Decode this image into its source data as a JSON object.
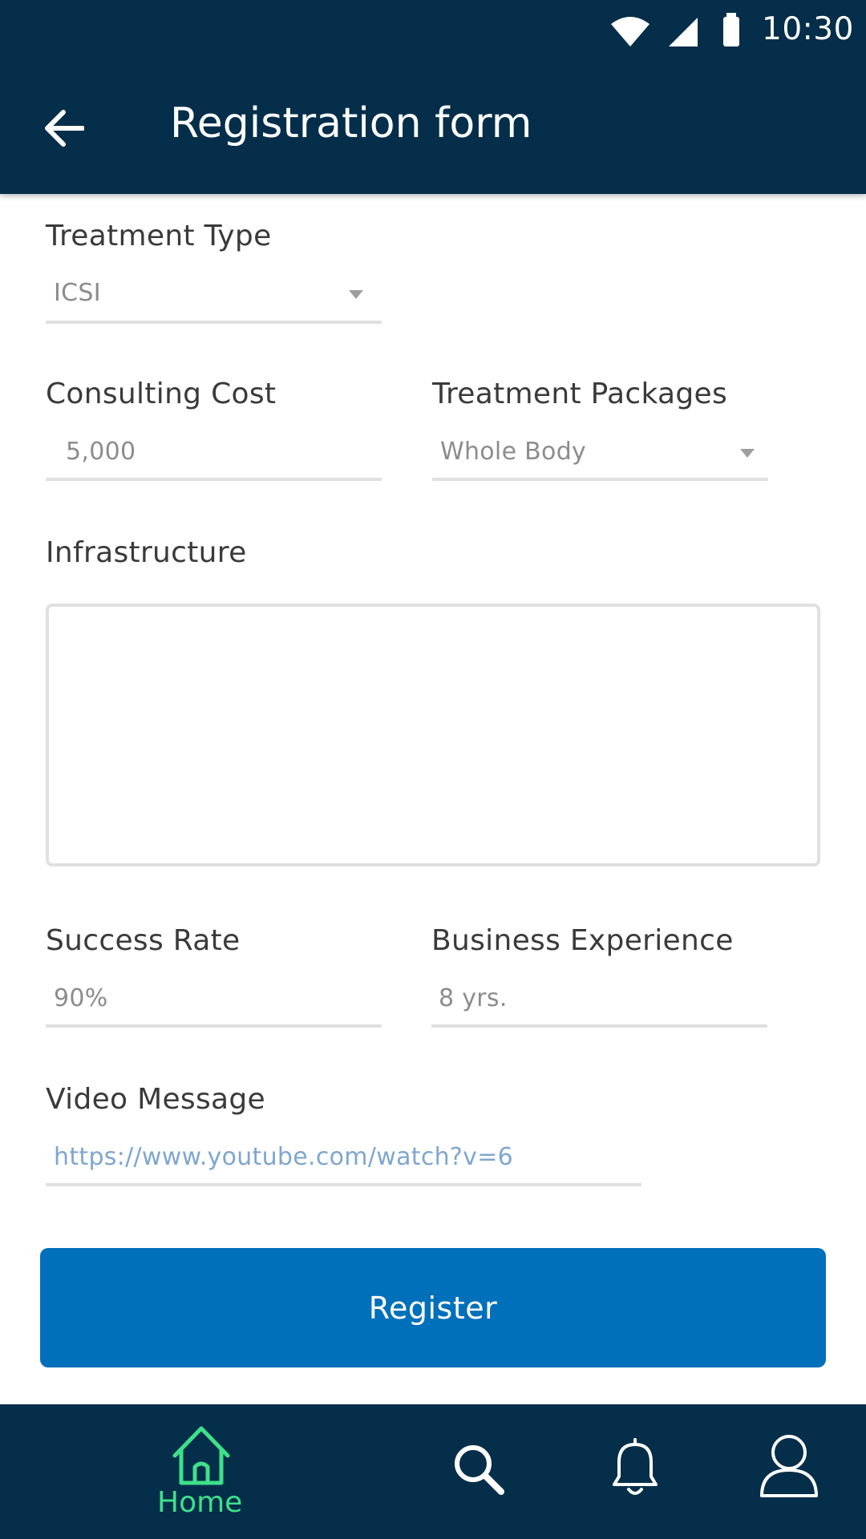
{
  "status_bar": {
    "time": "10:30",
    "icons": [
      "wifi-icon",
      "signal-icon",
      "battery-icon"
    ]
  },
  "app_bar": {
    "title": "Registration form",
    "back_icon": "arrow-left-icon"
  },
  "form": {
    "treatment_type": {
      "label": "Treatment Type",
      "value": "ICSI"
    },
    "consulting_cost": {
      "label": "Consulting Cost",
      "value": "5,000"
    },
    "treatment_packages": {
      "label": "Treatment Packages",
      "value": "Whole Body"
    },
    "infrastructure": {
      "label": "Infrastructure",
      "value": ""
    },
    "success_rate": {
      "label": "Success Rate",
      "value": "90%"
    },
    "business_experience": {
      "label": "Business Experience",
      "value": "8 yrs."
    },
    "video_message": {
      "label": "Video Message",
      "value": "https://www.youtube.com/watch?v=6"
    },
    "register_label": "Register"
  },
  "bottom_nav": {
    "home_label": "Home",
    "items": [
      "home-icon",
      "search-icon",
      "bell-icon",
      "user-icon"
    ]
  },
  "colors": {
    "primary_dark": "#052e4a",
    "button_blue": "#0070bb",
    "active_green": "#3ee08a",
    "link_value": "#7fa6cf"
  }
}
